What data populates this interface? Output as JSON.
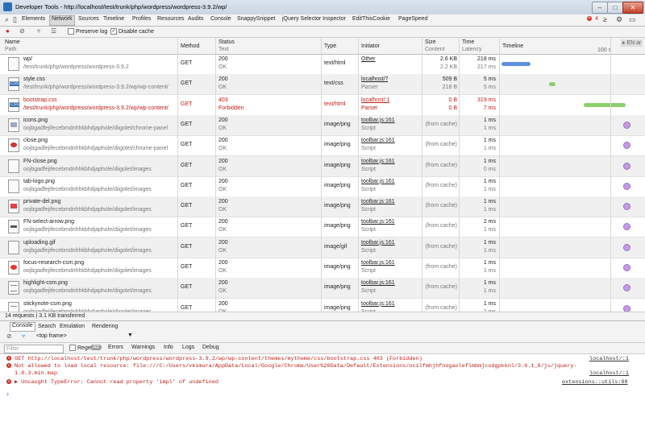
{
  "window": {
    "title": "Developer Tools - http://localhost/test/trunk/php/wordpress/wordpress-3.9.2/wp/"
  },
  "tabs": [
    "Elements",
    "Network",
    "Sources",
    "Timeline",
    "Profiles",
    "Resources",
    "Audits",
    "Console",
    "SnappySnippet",
    "jQuery Selector Inspector",
    "EditThisCookie",
    "PageSpeed"
  ],
  "active_tab": "Network",
  "error_count": "4",
  "toolbar": {
    "preserve_log": "Preserve log",
    "disable_cache": "Disable cache"
  },
  "columns": {
    "name": "Name",
    "path": "Path",
    "method": "Method",
    "status": "Status",
    "text": "Text",
    "type": "Type",
    "initiator": "Initiator",
    "size": "Size",
    "content": "Content",
    "time": "Time",
    "latency": "Latency",
    "timeline": "Timeline",
    "timeline_tick": "100 s",
    "timeline_right": "▸ EN ar"
  },
  "rows": [
    {
      "name": "wp/",
      "path": "/test/trunk/php/wordpress/wordpress-3.9.2",
      "method": "GET",
      "status": "200",
      "text": "OK",
      "type": "text/html",
      "init1": "Other",
      "init2": "",
      "size1": "2.6 KB",
      "size2": "2.2 KB",
      "time1": "218 ms",
      "time2": "217 ms",
      "icon": "doc",
      "tl": "bar-blue",
      "err": false
    },
    {
      "name": "style.css",
      "path": "/test/trunk/php/wordpress/wordpress-3.9.2/wp/wp-content/",
      "method": "GET",
      "status": "200",
      "text": "OK",
      "type": "text/css",
      "init1": "localhost/?",
      "init2": "Parser",
      "size1": "509 B",
      "size2": "218 B",
      "time1": "5 ms",
      "time2": "5 ms",
      "icon": "css",
      "tl": "dot-green",
      "err": false
    },
    {
      "name": "bootstrap.css",
      "path": "/test/trunk/php/wordpress/wordpress-3.9.2/wp/wp-content/",
      "method": "GET",
      "status": "403",
      "text": "Forbidden",
      "type": "text/html",
      "init1": "localhost/:1",
      "init2": "Parser",
      "size1": "0 B",
      "size2": "0 B",
      "time1": "319 ms",
      "time2": "7 ms",
      "icon": "css",
      "tl": "bar-green",
      "err": true
    },
    {
      "name": "icons.png",
      "path": "oojbgadfejifecebmdnhhkbhdjaphole/diigolet/chrome-panel",
      "method": "GET",
      "status": "200",
      "text": "OK",
      "type": "image/png",
      "init1": "toolbar.js:161",
      "init2": "Script",
      "size1": "(from cache)",
      "size2": "",
      "time1": "1 ms",
      "time2": "1 ms",
      "icon": "img",
      "tl": "dot-purple",
      "err": false
    },
    {
      "name": "close.png",
      "path": "oojbgadfejifecebmdnhhkbhdjaphole/diigolet/chrome-panel",
      "method": "GET",
      "status": "200",
      "text": "OK",
      "type": "image/png",
      "init1": "toolbar.js:161",
      "init2": "Script",
      "size1": "(from cache)",
      "size2": "",
      "time1": "1 ms",
      "time2": "1 ms",
      "icon": "close",
      "tl": "dot-purple",
      "err": false
    },
    {
      "name": "FN-close.png",
      "path": "oojbgadfejifecebmdnhhkbhdjaphole/diigolet/images",
      "method": "GET",
      "status": "200",
      "text": "OK",
      "type": "image/png",
      "init1": "toolbar.js:161",
      "init2": "Script",
      "size1": "(from cache)",
      "size2": "",
      "time1": "1 ms",
      "time2": "0 ms",
      "icon": "blank",
      "tl": "dot-purple",
      "err": false
    },
    {
      "name": "tab-logo.png",
      "path": "oojbgadfejifecebmdnhhkbhdjaphole/diigolet/images",
      "method": "GET",
      "status": "200",
      "text": "OK",
      "type": "image/png",
      "init1": "toolbar.js:161",
      "init2": "Script",
      "size1": "(from cache)",
      "size2": "",
      "time1": "1 ms",
      "time2": "1 ms",
      "icon": "blank",
      "tl": "dot-purple",
      "err": false
    },
    {
      "name": "private-del.png",
      "path": "oojbgadfejifecebmdnhhkbhdjaphole/diigolet/images",
      "method": "GET",
      "status": "200",
      "text": "OK",
      "type": "image/png",
      "init1": "toolbar.js:161",
      "init2": "Script",
      "size1": "(from cache)",
      "size2": "",
      "time1": "1 ms",
      "time2": "1 ms",
      "icon": "trash",
      "tl": "dot-purple",
      "err": false
    },
    {
      "name": "FN-select-arrow.png",
      "path": "oojbgadfejifecebmdnhhkbhdjaphole/diigolet/images",
      "method": "GET",
      "status": "200",
      "text": "OK",
      "type": "image/png",
      "init1": "toolbar.js:161",
      "init2": "Script",
      "size1": "(from cache)",
      "size2": "",
      "time1": "2 ms",
      "time2": "1 ms",
      "icon": "arrow",
      "tl": "dot-purple",
      "err": false
    },
    {
      "name": "uploading.gif",
      "path": "oojbgadfejifecebmdnhhkbhdjaphole/diigolet/images",
      "method": "GET",
      "status": "200",
      "text": "OK",
      "type": "image/gif",
      "init1": "toolbar.js:161",
      "init2": "Script",
      "size1": "(from cache)",
      "size2": "",
      "time1": "1 ms",
      "time2": "1 ms",
      "icon": "blank",
      "tl": "dot-purple",
      "err": false
    },
    {
      "name": "focus-research-csm.png",
      "path": "oojbgadfejifecebmdnhhkbhdjaphole/diigolet/images",
      "method": "GET",
      "status": "200",
      "text": "OK",
      "type": "image/png",
      "init1": "toolbar.js:161",
      "init2": "Script",
      "size1": "(from cache)",
      "size2": "",
      "time1": "1 ms",
      "time2": "1 ms",
      "icon": "red",
      "tl": "dot-purple",
      "err": false
    },
    {
      "name": "highlight-csm.png",
      "path": "oojbgadfejifecebmdnhhkbhdjaphole/diigolet/images",
      "method": "GET",
      "status": "200",
      "text": "OK",
      "type": "image/png",
      "init1": "toolbar.js:161",
      "init2": "Script",
      "size1": "(from cache)",
      "size2": "",
      "time1": "1 ms",
      "time2": "1 ms",
      "icon": "lines",
      "tl": "dot-purple",
      "err": false
    },
    {
      "name": "stickynote-csm.png",
      "path": "oojbgadfejifecebmdnhhkbhdjaphole/diigolet/images",
      "method": "GET",
      "status": "200",
      "text": "OK",
      "type": "image/png",
      "init1": "toolbar.js:161",
      "init2": "Script",
      "size1": "(from cache)",
      "size2": "",
      "time1": "1 ms",
      "time2": "1 ms",
      "icon": "lines",
      "tl": "dot-purple",
      "err": false
    }
  ],
  "summary": "14 requests | 3.1 KB transferred",
  "drawer_tabs": [
    "Console",
    "Search",
    "Emulation",
    "Rendering"
  ],
  "frame_select": "<top frame>",
  "filter_placeholder": "Filter",
  "regex": "Regex",
  "levels": [
    "All",
    "Errors",
    "Warnings",
    "Info",
    "Logs",
    "Debug"
  ],
  "console_lines": [
    {
      "text": "GET http://localhost/test/trunk/php/wordpress/wordpress-3.9.2/wp/wp-content/themes/mytheme/css/bootstrap.css 403 (Forbidden)",
      "src": "localhost/:1"
    },
    {
      "text": "Not allowed to load local resource: file:///C:/Users/vkimura/AppData/Local/Google/Chrome/User%20Data/Default/Extensions/ocilfmhjhfnogaoleflmbmjcodgpkknl/3.0.1_0/js/jquery-",
      "src": "localhost/:1"
    },
    {
      "text": "1.8.3.min.map",
      "src": ""
    },
    {
      "text": "▶ Uncaught TypeError: Cannot read property 'impl' of undefined",
      "src": "extensions::utils:88"
    }
  ],
  "colors": {
    "error": "#c41a16",
    "timeline_blue": "#5b8fe0",
    "timeline_green": "#8ad06e",
    "cache_dot": "#c59be6"
  }
}
